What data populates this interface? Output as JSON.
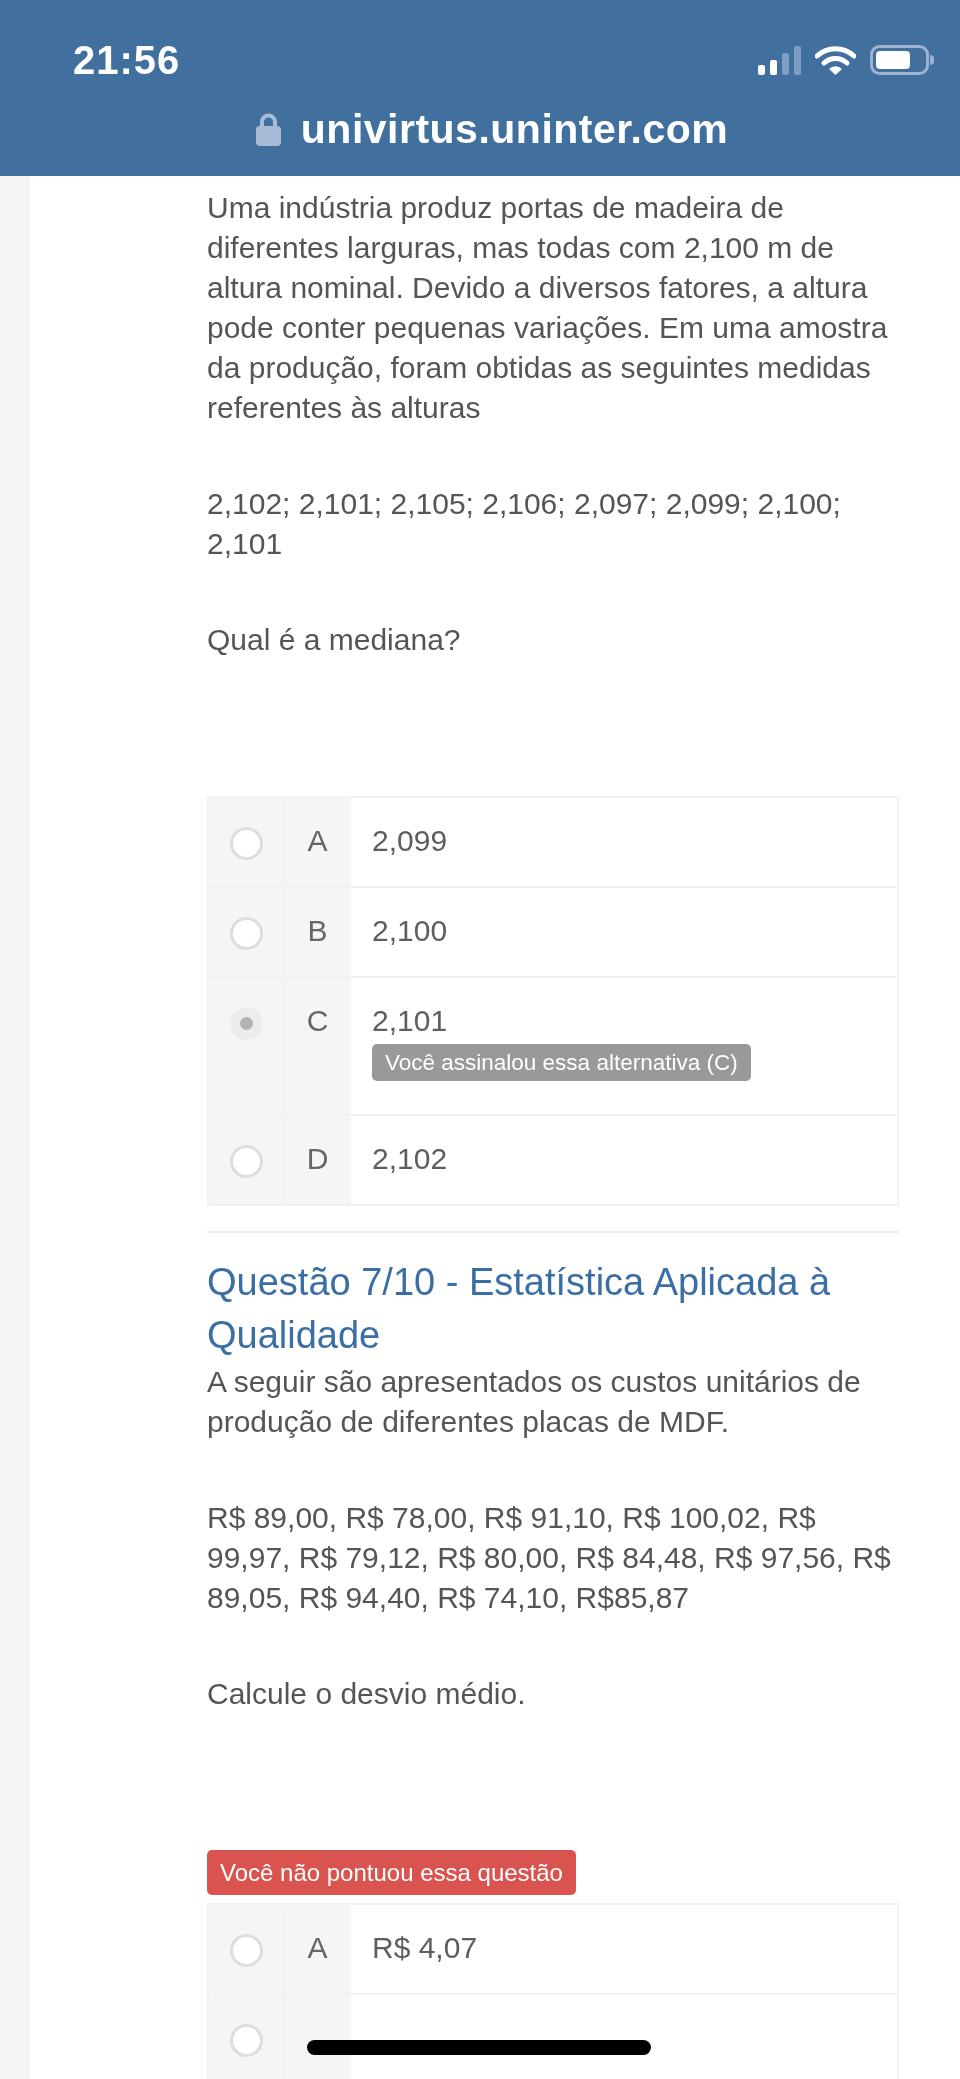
{
  "status_bar": {
    "time": "21:56"
  },
  "address_bar": {
    "url": "univirtus.uninter.com"
  },
  "questions": [
    {
      "paragraphs": [
        "Uma indústria produz portas de madeira de diferentes larguras, mas todas com 2,100 m de altura nominal. Devido a diversos fatores, a altura pode conter pequenas variações. Em uma amostra da produção, foram obtidas as seguintes medidas referentes às alturas",
        "2,102; 2,101; 2,105; 2,106; 2,097; 2,099; 2,100; 2,101",
        "Qual é a mediana?"
      ],
      "options": [
        {
          "letter": "A",
          "text": "2,099",
          "selected": false
        },
        {
          "letter": "B",
          "text": "2,100",
          "selected": false
        },
        {
          "letter": "C",
          "text": "2,101",
          "selected": true,
          "note": "Você assinalou essa alternativa (C)"
        },
        {
          "letter": "D",
          "text": "2,102",
          "selected": false
        }
      ]
    },
    {
      "title": "Questão 7/10 - Estatística Aplicada à Qualidade",
      "paragraphs": [
        "A seguir são apresentados os custos unitários de produção de diferentes placas de MDF.",
        "R$ 89,00, R$ 78,00, R$ 91,10, R$ 100,02, R$ 99,97, R$ 79,12, R$ 80,00, R$ 84,48, R$ 97,56, R$ 89,05, R$ 94,40, R$ 74,10, R$85,87",
        "Calcule o desvio médio."
      ],
      "result": "Você não pontuou essa questão",
      "options": [
        {
          "letter": "A",
          "text": "R$ 4,07",
          "selected": false
        },
        {
          "selected": false
        }
      ]
    }
  ]
}
